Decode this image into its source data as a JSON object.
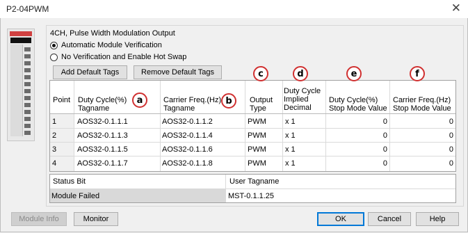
{
  "window": {
    "title": "P2-04PWM",
    "close_icon": "close-icon"
  },
  "module": {
    "description": "4CH, Pulse Width Modulation Output",
    "options": [
      {
        "label": "Automatic Module Verification",
        "selected": true
      },
      {
        "label": "No Verification and Enable Hot Swap",
        "selected": false
      }
    ]
  },
  "tag_buttons": {
    "add": "Add Default Tags",
    "remove": "Remove Default Tags"
  },
  "markers": [
    "a",
    "b",
    "c",
    "d",
    "e",
    "f"
  ],
  "table": {
    "headers": {
      "point": "Point",
      "duty_tag": [
        "Duty Cycle(%)",
        "Tagname"
      ],
      "carrier_tag": [
        "Carrier Freq.(Hz)",
        "Tagname"
      ],
      "output_type": [
        "Output",
        "Type"
      ],
      "implied": [
        "Duty Cycle",
        "Implied",
        "Decimal"
      ],
      "duty_stop": [
        "Duty Cycle(%)",
        "Stop Mode Value"
      ],
      "carrier_stop": [
        "Carrier Freq.(Hz)",
        "Stop Mode Value"
      ]
    },
    "rows": [
      {
        "point": "1",
        "duty_tag": "AOS32-0.1.1.1",
        "carrier_tag": "AOS32-0.1.1.2",
        "type": "PWM",
        "implied": "x 1",
        "duty_stop": "0",
        "carrier_stop": "0"
      },
      {
        "point": "2",
        "duty_tag": "AOS32-0.1.1.3",
        "carrier_tag": "AOS32-0.1.1.4",
        "type": "PWM",
        "implied": "x 1",
        "duty_stop": "0",
        "carrier_stop": "0"
      },
      {
        "point": "3",
        "duty_tag": "AOS32-0.1.1.5",
        "carrier_tag": "AOS32-0.1.1.6",
        "type": "PWM",
        "implied": "x 1",
        "duty_stop": "0",
        "carrier_stop": "0"
      },
      {
        "point": "4",
        "duty_tag": "AOS32-0.1.1.7",
        "carrier_tag": "AOS32-0.1.1.8",
        "type": "PWM",
        "implied": "x 1",
        "duty_stop": "0",
        "carrier_stop": "0"
      }
    ]
  },
  "status_table": {
    "headers": [
      "Status Bit",
      "User Tagname"
    ],
    "row": {
      "status_bit": "Module Failed",
      "user_tagname": "MST-0.1.1.25"
    }
  },
  "footer": {
    "module_info": "Module Info",
    "monitor": "Monitor",
    "ok": "OK",
    "cancel": "Cancel",
    "help": "Help"
  }
}
